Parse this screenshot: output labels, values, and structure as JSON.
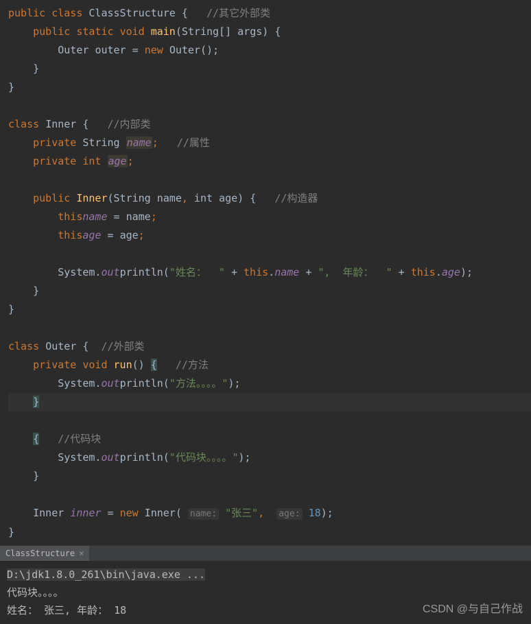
{
  "code": {
    "l1": {
      "kw1": "public",
      "kw2": "class",
      "name": "ClassStructure",
      "brace": "{",
      "cmt": "//其它外部类"
    },
    "l2": {
      "kw1": "public",
      "kw2": "static",
      "kw3": "void",
      "m": "main",
      "sig": "(String[] args) {"
    },
    "l3": {
      "type": "Outer",
      "var": "outer",
      "eq": "=",
      "kw": "new",
      "ctor": "Outer();"
    },
    "l4": {
      "brace": "}"
    },
    "l5": {
      "brace": "}"
    },
    "l6": {
      "kw": "class",
      "name": "Inner",
      "brace": "{",
      "cmt": "//内部类"
    },
    "l7": {
      "kw": "private",
      "type": "String",
      "field": "name",
      "semi": ";",
      "cmt": "//属性"
    },
    "l8": {
      "kw": "private",
      "type": "int",
      "field": "age",
      "semi": ";"
    },
    "l9": {
      "kw": "public",
      "ctor": "Inner",
      "sig": "(String name",
      "c1": ",",
      "sig2": " int age) {",
      "cmt": "//构造器"
    },
    "l10": {
      "kw": "this",
      ".": ".",
      "field": "name",
      "eq": "=",
      "var": "name",
      ";": ";"
    },
    "l11": {
      "kw": "this",
      ".": ".",
      "field": "age",
      "eq": "=",
      "var": "age",
      ";": ";"
    },
    "l12": {
      "obj": "System.",
      "out": "out",
      ".": ".",
      "m": "println",
      "p": "(",
      "s1": "\"姓名：  \"",
      "op1": " + ",
      "kw1": "this",
      "d1": ".",
      "f1": "name",
      "op2": " + ",
      "s2": "\",  年龄：  \"",
      "op3": " + ",
      "kw2": "this",
      "d2": ".",
      "f2": "age",
      "end": ");"
    },
    "l13": {
      "brace": "}"
    },
    "l14": {
      "brace": "}"
    },
    "l15": {
      "kw": "class",
      "name": "Outer",
      "brace": "{",
      "cmt": "//外部类"
    },
    "l16": {
      "kw1": "private",
      "kw2": "void",
      "m": "run",
      "sig": "()",
      "brace": "{",
      "cmt": "//方法"
    },
    "l17": {
      "obj": "System.",
      "out": "out",
      ".": ".",
      "m": "println",
      "p": "(",
      "s": "\"方法。。。。\"",
      "end": ");"
    },
    "l18": {
      "brace": "}"
    },
    "l19": {
      "brace": "{",
      "cmt": "//代码块"
    },
    "l20": {
      "obj": "System.",
      "out": "out",
      ".": ".",
      "m": "println",
      "p": "(",
      "s": "\"代码块。。。。\"",
      "end": ");"
    },
    "l21": {
      "brace": "}"
    },
    "l22": {
      "type": "Inner",
      "var": "inner",
      "eq": "=",
      "kw": "new",
      "ctor": "Inner(",
      "h1": "name:",
      "s": "\"张三\"",
      "c": ",",
      "h2": "age:",
      "n": "18",
      "end": ");"
    },
    "l23": {
      "brace": "}"
    }
  },
  "tab": {
    "name": "ClassStructure",
    "close": "×"
  },
  "console": {
    "cmd": "D:\\jdk1.8.0_261\\bin\\java.exe ...",
    "line1": "代码块。。。。",
    "line2": "姓名：  张三,  年龄：  18"
  },
  "watermark": "CSDN @与自己作战"
}
